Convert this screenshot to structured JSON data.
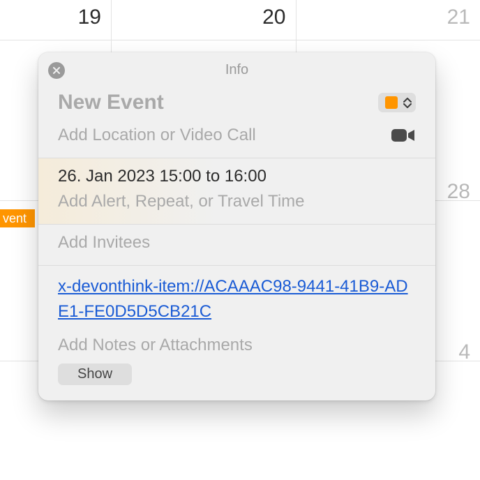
{
  "calendar_grid": {
    "row1": {
      "day1": "19",
      "day2": "20",
      "day3": "21"
    },
    "row2_day3": "28",
    "row3_day3": "4"
  },
  "event_chip": {
    "label": "vent"
  },
  "popover": {
    "title": "Info",
    "event_title_placeholder": "New Event",
    "calendar_color": "#ff9500",
    "location_placeholder": "Add Location or Video Call",
    "datetime": "26. Jan 2023  15:00 to 16:00",
    "alert_placeholder": "Add Alert, Repeat, or Travel Time",
    "invitees_placeholder": "Add Invitees",
    "url": "x-devonthink-item://ACAAAC98-9441-41B9-ADE1-FE0D5D5CB21C",
    "notes_placeholder": "Add Notes or Attachments",
    "show_button": "Show"
  }
}
